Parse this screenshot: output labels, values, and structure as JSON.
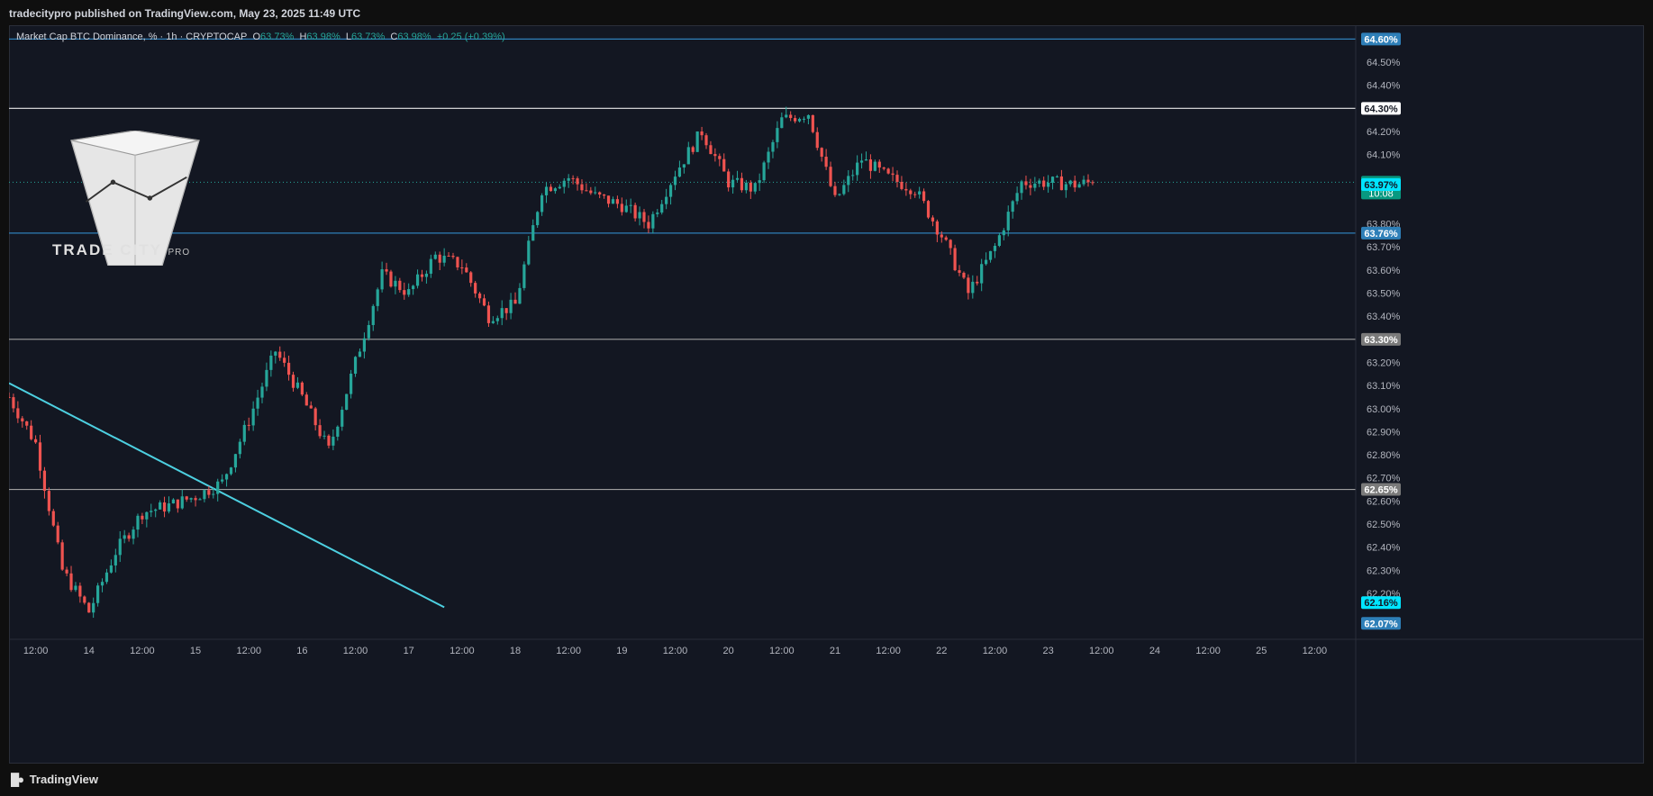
{
  "header": {
    "publisher_line": "tradecitypro published on TradingView.com, May 23, 2025 11:49 UTC"
  },
  "legend": {
    "symbol": "Market Cap BTC Dominance, % · 1h · CRYPTOCAP",
    "o_label": "O",
    "o": "63.73%",
    "h_label": "H",
    "h": "63.98%",
    "l_label": "L",
    "l": "63.73%",
    "c_label": "C",
    "c": "63.98%",
    "change": "+0.25 (+0.39%)"
  },
  "watermark": {
    "brand": "TRADE CITY",
    "sub": "PRO"
  },
  "footer": {
    "brand": "TradingView"
  },
  "colors": {
    "up": "#26a69a",
    "down": "#ef5350",
    "background": "#131722",
    "trendline": "#4dd0e1",
    "level_blue": "#2e7fb8",
    "level_white": "#e8e8e8",
    "level_grey": "#9e9e9e"
  },
  "chart_data": {
    "type": "candlestick",
    "timeframe": "1h",
    "ylim": [
      62.04,
      64.66
    ],
    "x_ticks": [
      "12:00",
      "14",
      "12:00",
      "15",
      "12:00",
      "16",
      "12:00",
      "17",
      "12:00",
      "18",
      "12:00",
      "19",
      "12:00",
      "20",
      "12:00",
      "21",
      "12:00",
      "22",
      "12:00",
      "23",
      "12:00",
      "24",
      "12:00",
      "25",
      "12:00"
    ],
    "y_ticks": [
      "64.50%",
      "64.40%",
      "64.20%",
      "64.10%",
      "63.80%",
      "63.70%",
      "63.60%",
      "63.50%",
      "63.40%",
      "63.20%",
      "63.10%",
      "63.00%",
      "62.90%",
      "62.80%",
      "62.70%",
      "62.60%",
      "62.50%",
      "62.40%",
      "62.30%",
      "62.20%"
    ],
    "levels": [
      {
        "value": 64.6,
        "label": "64.60%",
        "kind": "blue"
      },
      {
        "value": 64.3,
        "label": "64.30%",
        "kind": "white"
      },
      {
        "value": 63.76,
        "label": "63.76%",
        "kind": "blue"
      },
      {
        "value": 63.3,
        "label": "63.30%",
        "kind": "grey"
      },
      {
        "value": 62.65,
        "label": "62.65%",
        "kind": "grey"
      }
    ],
    "price_tags": [
      {
        "value": 63.98,
        "label": "63.98%",
        "sub": "10:08",
        "kind": "last"
      },
      {
        "value": 63.97,
        "label": "63.97%",
        "kind": "cyan"
      },
      {
        "value": 62.16,
        "label": "62.16%",
        "kind": "cyan"
      },
      {
        "value": 62.07,
        "label": "62.07%",
        "kind": "blue"
      }
    ],
    "trendline": {
      "start_x": "13 May 06:00",
      "start_y": 63.11,
      "end_x": "17 May 08:00",
      "end_y": 62.14
    },
    "series": [
      {
        "name": "BTC Dominance",
        "x": [
          "13 May 06:00",
          "13 May 12:00",
          "13 May 18:00",
          "14 May 00:00",
          "14 May 06:00",
          "14 May 12:00",
          "14 May 18:00",
          "15 May 00:00",
          "15 May 06:00",
          "15 May 12:00",
          "15 May 18:00",
          "16 May 00:00",
          "16 May 06:00",
          "16 May 12:00",
          "16 May 18:00",
          "17 May 00:00",
          "17 May 06:00",
          "17 May 12:00",
          "17 May 18:00",
          "18 May 00:00",
          "18 May 06:00",
          "18 May 12:00",
          "18 May 18:00",
          "19 May 00:00",
          "19 May 06:00",
          "19 May 12:00",
          "19 May 18:00",
          "20 May 00:00",
          "20 May 06:00",
          "20 May 12:00",
          "20 May 18:00",
          "21 May 00:00",
          "21 May 06:00",
          "21 May 12:00",
          "21 May 18:00",
          "22 May 00:00",
          "22 May 06:00",
          "22 May 12:00",
          "22 May 18:00",
          "23 May 00:00",
          "23 May 06:00",
          "23 May 10:00"
        ],
        "y": [
          63.05,
          62.85,
          62.3,
          62.12,
          62.38,
          62.55,
          62.58,
          62.62,
          62.68,
          62.95,
          63.25,
          63.05,
          62.82,
          63.2,
          63.58,
          63.5,
          63.66,
          63.62,
          63.4,
          63.45,
          63.95,
          64.0,
          63.92,
          63.88,
          63.8,
          64.02,
          64.2,
          63.98,
          63.95,
          64.25,
          64.28,
          63.9,
          64.08,
          64.0,
          63.95,
          63.75,
          63.5,
          63.7,
          63.98,
          63.98,
          63.97,
          63.98
        ]
      }
    ]
  }
}
